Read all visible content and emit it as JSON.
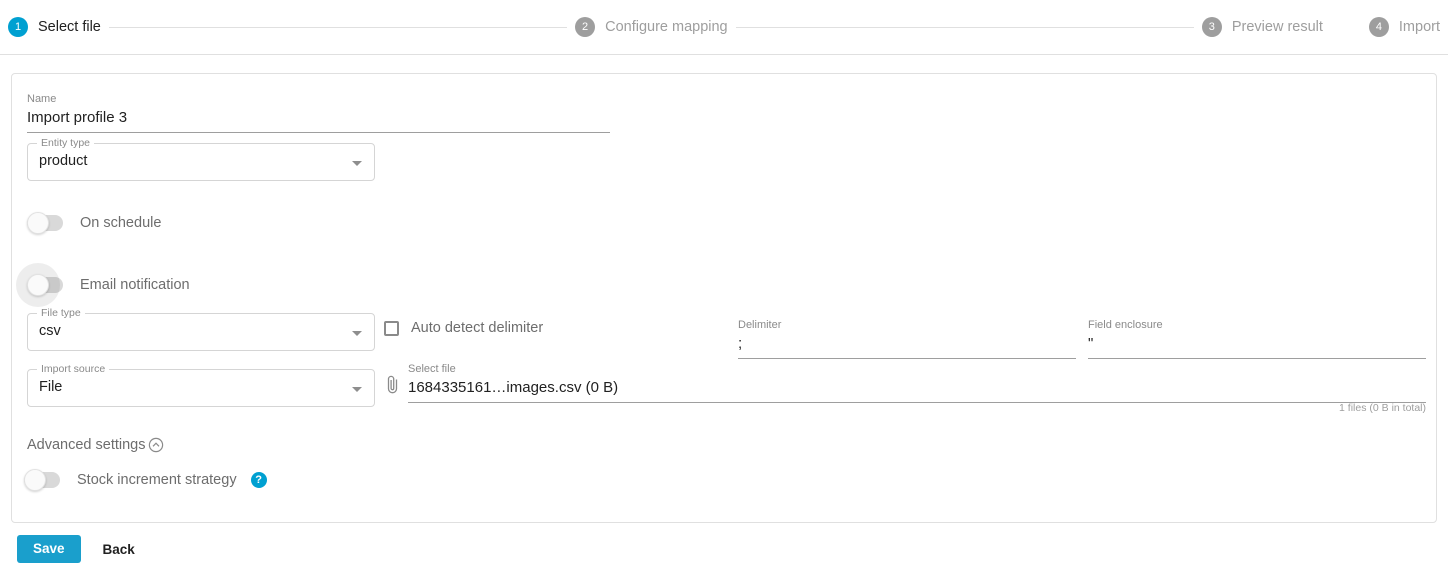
{
  "stepper": {
    "steps": [
      {
        "num": "1",
        "label": "Select file",
        "state": "active"
      },
      {
        "num": "2",
        "label": "Configure mapping",
        "state": "inactive"
      },
      {
        "num": "3",
        "label": "Preview result",
        "state": "inactive"
      },
      {
        "num": "4",
        "label": "Import",
        "state": "inactive"
      }
    ]
  },
  "form": {
    "name": {
      "label": "Name",
      "value": "Import profile 3"
    },
    "entity_type": {
      "label": "Entity type",
      "value": "product"
    },
    "on_schedule": {
      "label": "On schedule",
      "state": "off"
    },
    "email_notification": {
      "label": "Email notification",
      "state": "off"
    },
    "file_type": {
      "label": "File type",
      "value": "csv"
    },
    "auto_detect_delimiter": {
      "label": "Auto detect delimiter",
      "checked": "false"
    },
    "delimiter": {
      "label": "Delimiter",
      "value": ";"
    },
    "field_enclosure": {
      "label": "Field enclosure",
      "value": "\""
    },
    "import_source": {
      "label": "Import source",
      "value": "File"
    },
    "select_file": {
      "label": "Select file",
      "value": "1684335161…images.csv (0 B)"
    },
    "files_total": "1 files (0 B in total)",
    "advanced_settings": {
      "label": "Advanced settings"
    },
    "stock_increment_strategy": {
      "label": "Stock increment strategy",
      "state": "off",
      "help": "?"
    }
  },
  "footer": {
    "save_label": "Save",
    "back_label": "Back"
  },
  "colors": {
    "accent": "#00a0d1",
    "save_button": "#1a9fcc",
    "inactive_step": "#9e9e9e",
    "border": "#e0e0e0"
  }
}
